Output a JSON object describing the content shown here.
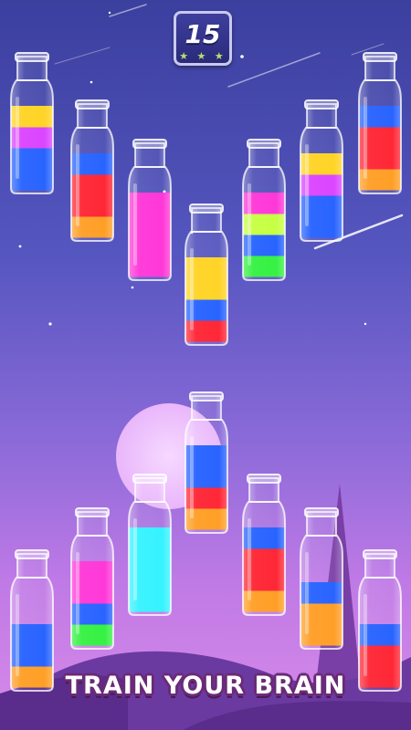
{
  "level": {
    "number": "15",
    "stars": "★ ★ ★"
  },
  "slogan": "TRAIN YOUR BRAIN",
  "palette": {
    "blue": "#1e5cff",
    "magenta": "#d93cff",
    "yellow": "#ffd21c",
    "red": "#ff1c2c",
    "orange": "#ff9a1c",
    "pink": "#ff2ed6",
    "green": "#2cf03a",
    "lime": "#c4ff3a",
    "cyan": "#2cf2ff"
  },
  "bottles": [
    {
      "id": "bottle-1",
      "colors": [
        "blue",
        "blue",
        "magenta",
        "yellow"
      ]
    },
    {
      "id": "bottle-2",
      "colors": [
        "orange",
        "red",
        "red",
        "blue"
      ]
    },
    {
      "id": "bottle-3",
      "colors": [
        "pink",
        "pink",
        "pink",
        "pink"
      ]
    },
    {
      "id": "bottle-4",
      "colors": [
        "red",
        "blue",
        "yellow",
        "yellow"
      ]
    },
    {
      "id": "bottle-5",
      "colors": [
        "green",
        "blue",
        "lime",
        "pink"
      ]
    },
    {
      "id": "bottle-6",
      "colors": [
        "blue",
        "blue",
        "magenta",
        "yellow"
      ]
    },
    {
      "id": "bottle-7",
      "colors": [
        "orange",
        "red",
        "red",
        "blue"
      ]
    },
    {
      "id": "bottle-8",
      "colors": [
        "orange",
        "red",
        "blue",
        "blue"
      ]
    },
    {
      "id": "bottle-9",
      "colors": [
        "orange",
        "blue",
        "blue"
      ]
    },
    {
      "id": "bottle-10",
      "colors": [
        "green",
        "blue",
        "pink",
        "pink"
      ]
    },
    {
      "id": "bottle-11",
      "colors": [
        "cyan",
        "cyan",
        "cyan",
        "cyan"
      ]
    },
    {
      "id": "bottle-12",
      "colors": [
        "orange",
        "red",
        "red",
        "blue"
      ]
    },
    {
      "id": "bottle-13",
      "colors": [
        "orange",
        "orange",
        "blue"
      ]
    },
    {
      "id": "bottle-14",
      "colors": [
        "red",
        "red",
        "blue"
      ]
    }
  ]
}
